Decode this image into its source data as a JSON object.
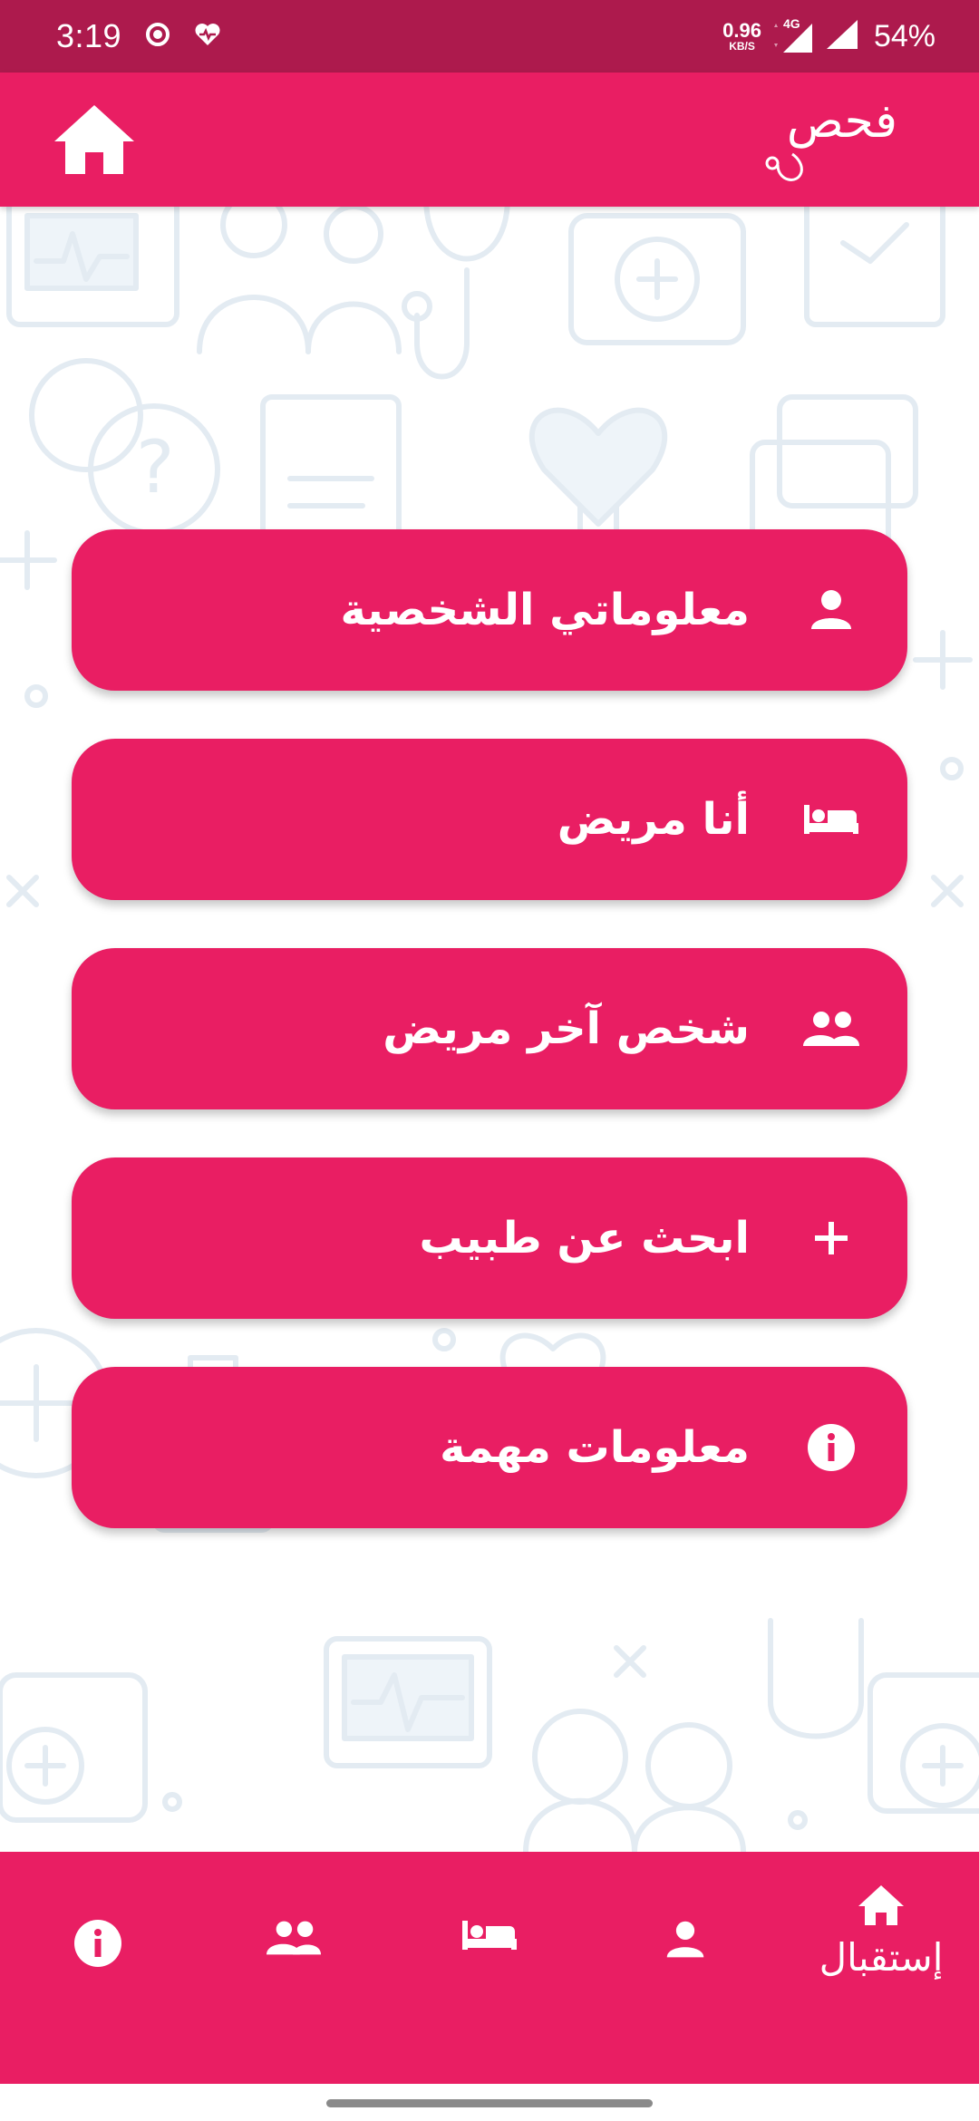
{
  "status_bar": {
    "time": "3:19",
    "net_speed_value": "0.96",
    "net_speed_unit": "KB/S",
    "network_type": "4G",
    "battery": "54%"
  },
  "app_bar": {
    "logo_text": "فحص",
    "home_icon": "home-icon",
    "color": "#e91e63"
  },
  "menu": {
    "items": [
      {
        "label": "معلوماتي الشخصية",
        "icon": "person-icon"
      },
      {
        "label": "أنا مريض",
        "icon": "bed-icon"
      },
      {
        "label": "شخص آخر مريض",
        "icon": "people-icon"
      },
      {
        "label": "ابحث عن طبيب",
        "icon": "plus-icon"
      },
      {
        "label": "معلومات مهمة",
        "icon": "info-icon"
      }
    ]
  },
  "bottom_nav": {
    "items": [
      {
        "label": "إستقبال",
        "icon": "home-icon",
        "active": true
      },
      {
        "label": "",
        "icon": "person-icon"
      },
      {
        "label": "",
        "icon": "bed-icon"
      },
      {
        "label": "",
        "icon": "people-icon"
      },
      {
        "label": "",
        "icon": "info-icon"
      }
    ]
  },
  "colors": {
    "primary": "#e91e63",
    "status_bar": "#ad1a4d",
    "background_pattern": "#e3ebf2"
  }
}
